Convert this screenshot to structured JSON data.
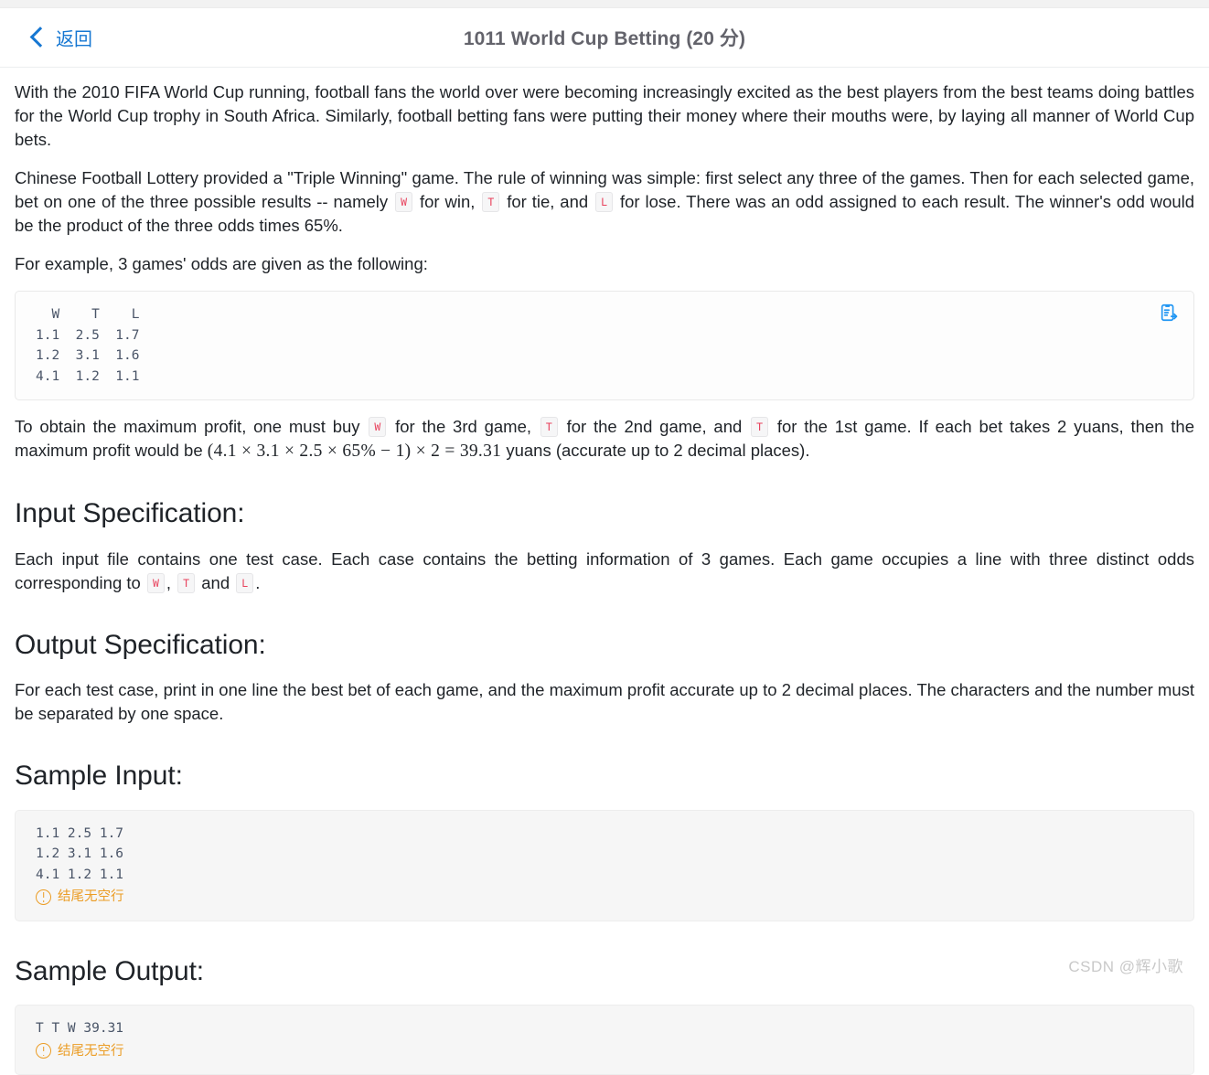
{
  "header": {
    "back_label": "返回",
    "title": "1011 World Cup Betting (20 分)",
    "back_icon": "chevron-left-icon",
    "accent_color": "#1677d2",
    "title_color": "#63636b"
  },
  "body": {
    "para1": "With the 2010 FIFA World Cup running, football fans the world over were becoming increasingly excited as the best players from the best teams doing battles for the World Cup trophy in South Africa. Similarly, football betting fans were putting their money where their mouths were, by laying all manner of World Cup bets.",
    "para2_a": "Chinese Football Lottery provided a \"Triple Winning\" game. The rule of winning was simple: first select any three of the games. Then for each selected game, bet on one of the three possible results -- namely",
    "para2_b": "for win,",
    "para2_c": "for tie, and",
    "para2_d": "for lose. There was an odd assigned to each result. The winner's odd would be the product of the three odds times 65%.",
    "para3": "For example, 3 games' odds are given as the following:",
    "para4_a": "To obtain the maximum profit, one must buy",
    "para4_b": "for the 3rd game,",
    "para4_c": "for the 2nd game, and",
    "para4_d": "for the 1st game. If each bet takes 2 yuans, then the maximum profit would be",
    "para4_e": "yuans (accurate up to 2 decimal places).",
    "formula": "(4.1 × 3.1 × 2.5 × 65% − 1) × 2 = 39.31",
    "chip_w": "W",
    "chip_t": "T",
    "chip_l": "L",
    "chip_color": "#e8415c"
  },
  "sections": {
    "input_spec_title": "Input Specification:",
    "input_spec_text_a": "Each input file contains one test case. Each case contains the betting information of 3 games. Each game occupies a line with three distinct odds corresponding to",
    "input_spec_comma": ",",
    "input_spec_and": "and",
    "input_spec_period": ".",
    "output_spec_title": "Output Specification:",
    "output_spec_text": "For each test case, print in one line the best bet of each game, and the maximum profit accurate up to 2 decimal places. The characters and the number must be separated by one space.",
    "sample_input_title": "Sample Input:",
    "sample_output_title": "Sample Output:"
  },
  "code_blocks": {
    "odds_table": "  W    T    L\n1.1  2.5  1.7\n1.2  3.1  1.6\n4.1  1.2  1.1",
    "sample_input": "1.1 2.5 1.7\n1.2 3.1 1.6\n4.1 1.2 1.1",
    "sample_output": "T T W 39.31",
    "warning_text": "结尾无空行",
    "warning_color": "#eb9c24",
    "copy_icon": "copy-clipboard-icon"
  },
  "watermark": {
    "text": "CSDN @辉小歌"
  }
}
